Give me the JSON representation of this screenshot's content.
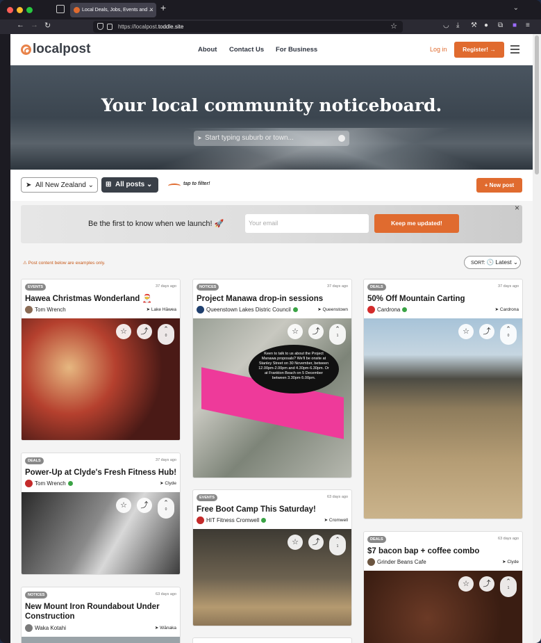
{
  "browser": {
    "tab_title": "Local Deals, Jobs, Events and ...",
    "url_prefix": "https://localpost.",
    "url_domain": "toddle.site"
  },
  "header": {
    "logo_text": "localpost",
    "nav": [
      "About",
      "Contact Us",
      "For Business"
    ],
    "login": "Log in",
    "register": "Register! →"
  },
  "hero": {
    "title": "Your local community noticeboard.",
    "search_placeholder": "Start typing suburb or town..."
  },
  "filters": {
    "location": "All New Zealand",
    "posts": "All posts",
    "hint": "tap to filter!",
    "new_post": "+ New post"
  },
  "banner": {
    "text": "Be the first to know when we launch! 🚀",
    "email_placeholder": "Your email",
    "button": "Keep me updated!"
  },
  "notice": "⚠ Post content below are examples only.",
  "sort": {
    "label": "SORT:",
    "value": "Latest"
  },
  "cards": [
    {
      "badge": "EVENTS",
      "ago": "37 days ago",
      "title": "Hawea Christmas Wonderland 🎅",
      "author": "Tom Wrench",
      "location": "Lake Hāwea",
      "votes": "0"
    },
    {
      "badge": "DEALS",
      "ago": "37 days ago",
      "title": "Power-Up at Clyde's Fresh Fitness Hub!",
      "author": "Tom Wrench",
      "location": "Clyde",
      "votes": "0"
    },
    {
      "badge": "NOTICES",
      "ago": "63 days ago",
      "title": "New Mount Iron Roundabout Under Construction",
      "author": "Waka Kotahi",
      "location": "Wānaka",
      "votes": "0"
    },
    {
      "badge": "NOTICES",
      "ago": "37 days ago",
      "title": "Project Manawa drop-in sessions",
      "author": "Queenstown Lakes Distric Council",
      "location": "Queenstown",
      "votes": "1",
      "bubble": "Keen to talk to us about the Project Manawa proposals? We'll be onsite at Stanley Street on 30 November, between 12.00pm-2.00pm and 4.30pm-6.30pm. Or at Frankton Beach on 5 December between 3.30pm-5.00pm."
    },
    {
      "badge": "EVENTS",
      "ago": "63 days ago",
      "title": "Free Boot Camp This Saturday!",
      "author": "HIT Fitness Cromwell",
      "location": "Cromwell",
      "votes": "1"
    },
    {
      "badge": "DEALS",
      "ago": "37 days ago",
      "title": "50% Off Mountain Carting",
      "author": "Cardrona",
      "location": "Cardrona",
      "votes": "0"
    },
    {
      "badge": "DEALS",
      "ago": "63 days ago",
      "title": "$7 bacon bap + coffee combo",
      "author": "Grinder Beans Cafe",
      "location": "Clyde",
      "votes": "1"
    }
  ]
}
